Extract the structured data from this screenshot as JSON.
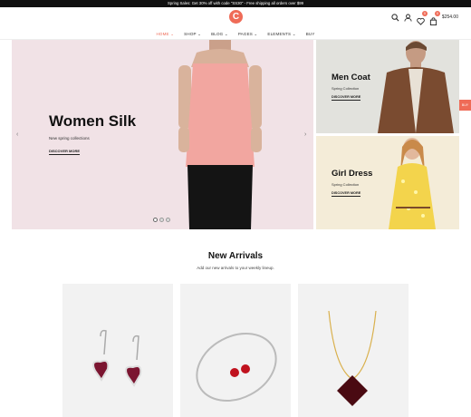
{
  "topbar": {
    "text": "Spring Sales: Get 30% off with code \"SS30\" - Free shipping all orders over $99"
  },
  "header": {
    "logo_letter": "C",
    "cart_badge": "0",
    "wishlist_badge": "0",
    "cart_total": "$254.00"
  },
  "nav": {
    "items": [
      {
        "label": "HOME ⌄"
      },
      {
        "label": "SHOP ⌄"
      },
      {
        "label": "BLOG ⌄"
      },
      {
        "label": "PAGES ⌄"
      },
      {
        "label": "ELEMENTS ⌄"
      },
      {
        "label": "BUY"
      }
    ]
  },
  "hero": {
    "title": "Women Silk",
    "subtitle": "New spring collections",
    "link": "DISCOVER MORE",
    "prev_arrow": "‹",
    "next_arrow": "›"
  },
  "promos": [
    {
      "title": "Men Coat",
      "subtitle": "Spring Collection",
      "link": "DISCOVER MORE"
    },
    {
      "title": "Girl Dress",
      "subtitle": "Spring Collection",
      "link": "DISCOVER MORE"
    }
  ],
  "side_tab": {
    "label": "BUY"
  },
  "new_arrivals": {
    "title": "New Arrivals",
    "subtitle": "Add our new arrivals to your weekly lineup."
  },
  "colors": {
    "accent": "#ef6b57",
    "hero_bg": "#f1e2e6",
    "promo1_bg": "#e2e2dd",
    "promo2_bg": "#f4ecd8"
  },
  "icons": [
    "search-icon",
    "user-icon",
    "heart-icon",
    "bag-icon"
  ]
}
